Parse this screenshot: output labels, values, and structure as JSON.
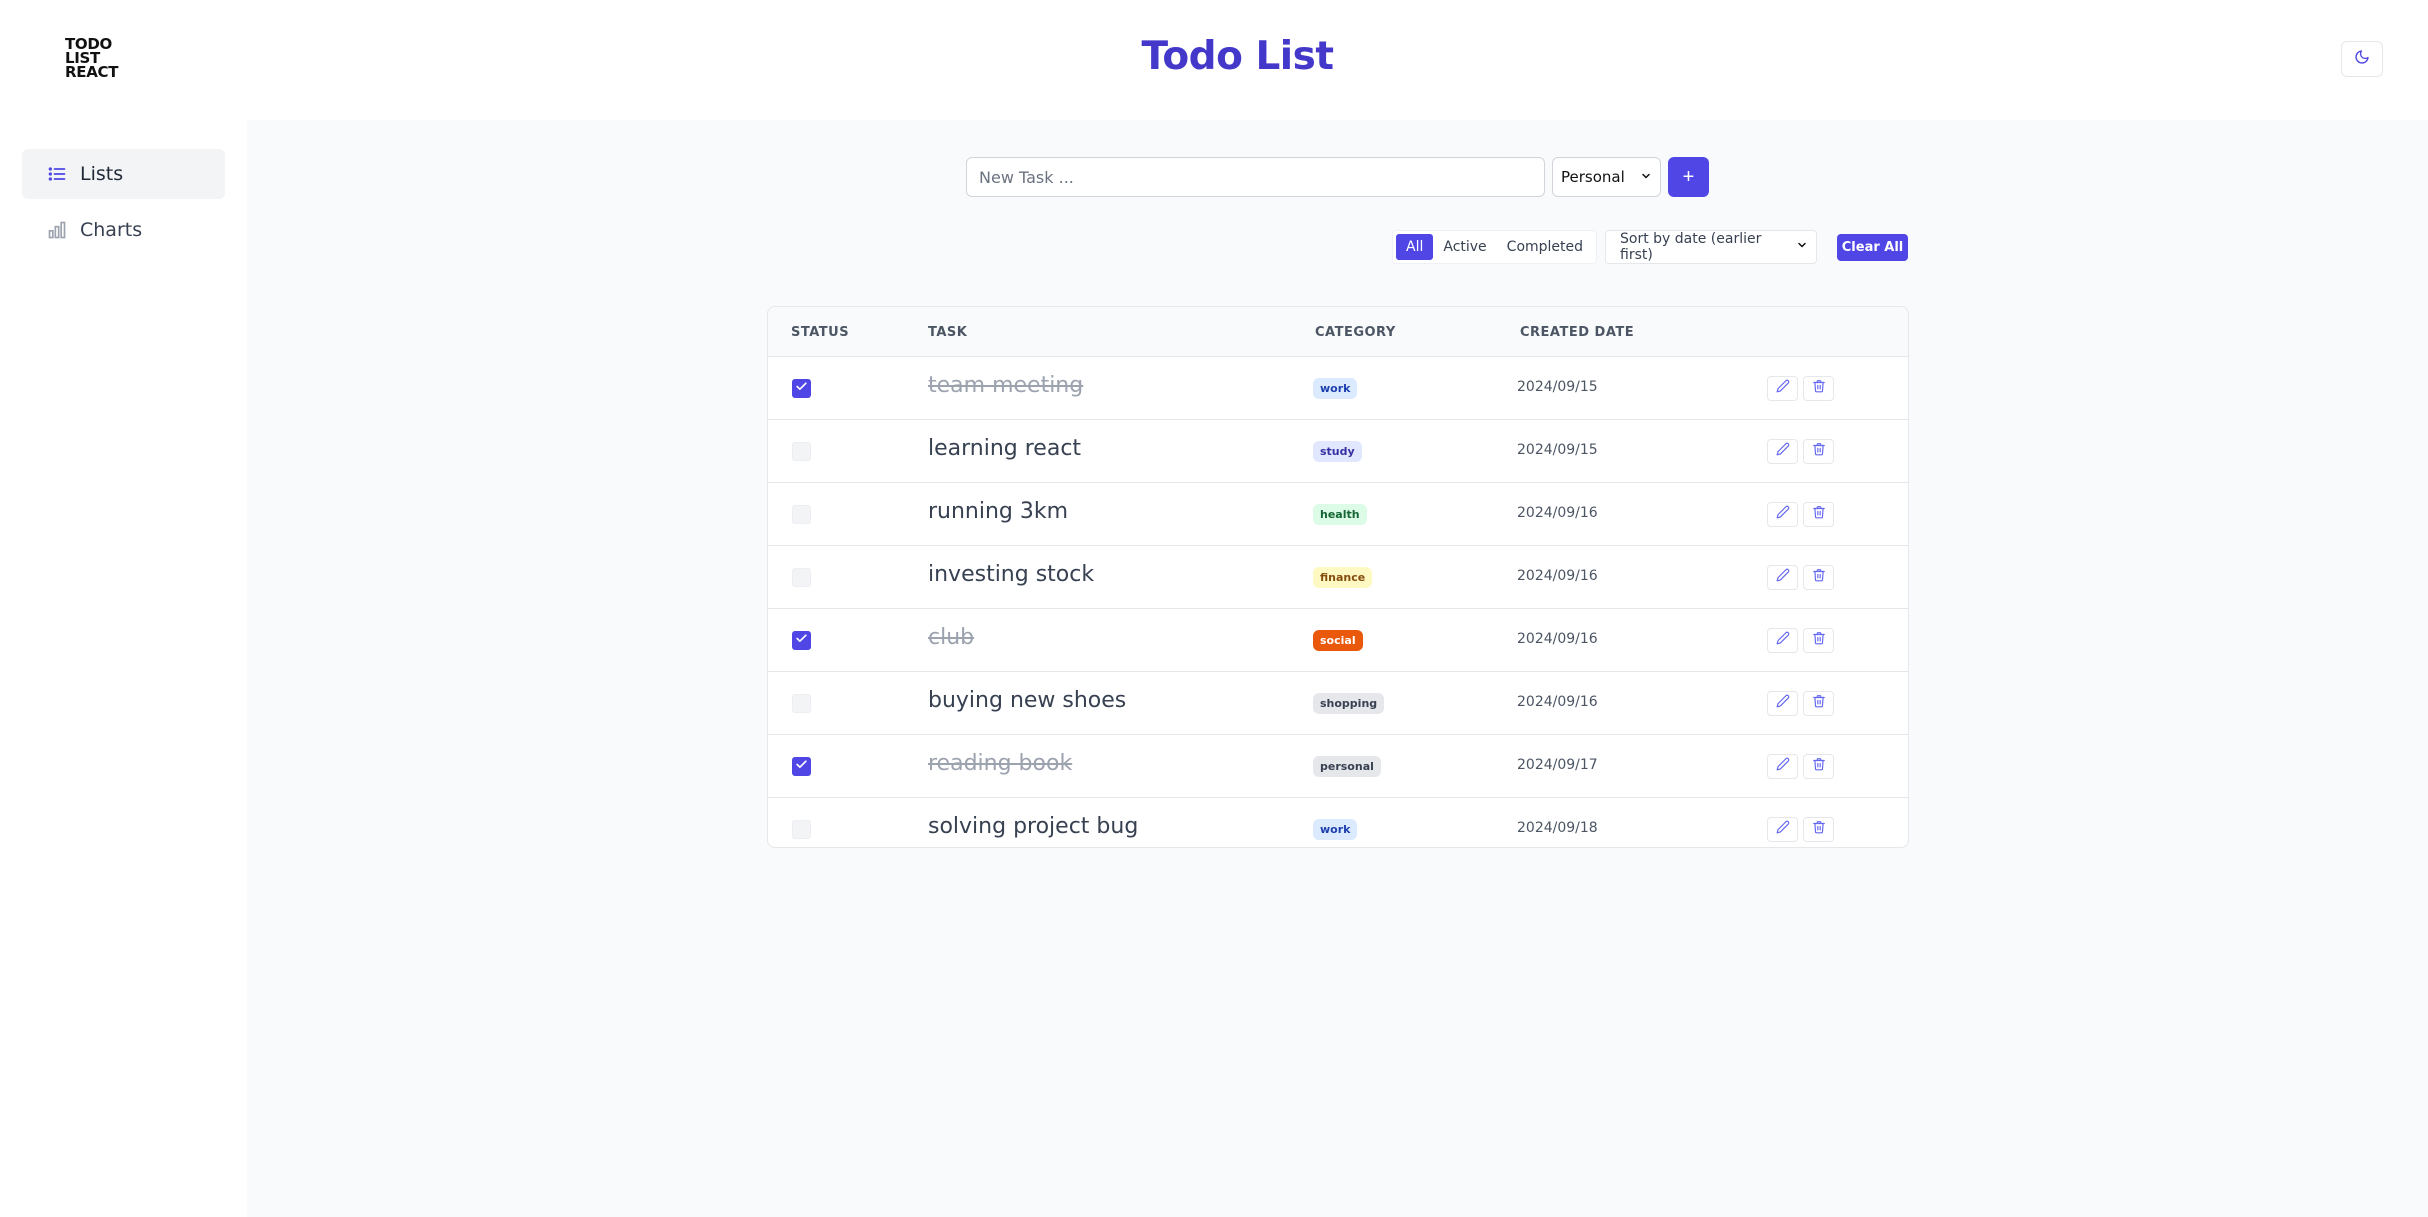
{
  "logo": {
    "line1": "TODO",
    "line2": "LIST",
    "line3": "REACT"
  },
  "header": {
    "title": "Todo List",
    "theme_toggle_icon": "moon-icon"
  },
  "sidebar": {
    "items": [
      {
        "label": "Lists",
        "icon": "list-icon",
        "active": true
      },
      {
        "label": "Charts",
        "icon": "bar-chart-icon",
        "active": false
      }
    ]
  },
  "new_task": {
    "placeholder": "New Task ...",
    "value": ""
  },
  "category_select": {
    "selected": "Personal"
  },
  "add_button": {
    "label": "+"
  },
  "filters": {
    "items": [
      "All",
      "Active",
      "Completed"
    ],
    "active": "All"
  },
  "sort": {
    "selected": "Sort by date (earlier first)"
  },
  "clear_all": {
    "label": "Clear All"
  },
  "table": {
    "headers": {
      "status": "STATUS",
      "task": "TASK",
      "category": "CATEGORY",
      "created": "CREATED DATE"
    },
    "rows": [
      {
        "done": true,
        "task": "team meeting",
        "category": "work",
        "date": "2024/09/15"
      },
      {
        "done": false,
        "task": "learning react",
        "category": "study",
        "date": "2024/09/15"
      },
      {
        "done": false,
        "task": "running 3km",
        "category": "health",
        "date": "2024/09/16"
      },
      {
        "done": false,
        "task": "investing stock",
        "category": "finance",
        "date": "2024/09/16"
      },
      {
        "done": true,
        "task": "club",
        "category": "social",
        "date": "2024/09/16"
      },
      {
        "done": false,
        "task": "buying new shoes",
        "category": "shopping",
        "date": "2024/09/16"
      },
      {
        "done": true,
        "task": "reading book",
        "category": "personal",
        "date": "2024/09/17"
      },
      {
        "done": false,
        "task": "solving project bug",
        "category": "work",
        "date": "2024/09/18"
      }
    ]
  },
  "category_colors": {
    "work": {
      "bg": "#dbeafe",
      "fg": "#1e40af"
    },
    "study": {
      "bg": "#e0e7ff",
      "fg": "#3730a3"
    },
    "health": {
      "bg": "#dcfce7",
      "fg": "#166534"
    },
    "finance": {
      "bg": "#fef9c3",
      "fg": "#854d0e"
    },
    "social": {
      "bg": "#ea580c",
      "fg": "#ffffff"
    },
    "shopping": {
      "bg": "#e5e7eb",
      "fg": "#374151"
    },
    "personal": {
      "bg": "#e5e7eb",
      "fg": "#374151"
    }
  },
  "accent_color": "#4f46e5"
}
